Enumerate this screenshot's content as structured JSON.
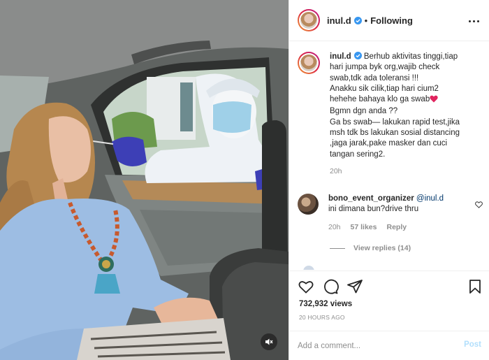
{
  "post": {
    "username": "inul.d",
    "follow_status": "Following",
    "separator": "•",
    "verified_icon": "verified-badge-icon",
    "photo_icon": "photo"
  },
  "caption": {
    "username": "inul.d",
    "lines": [
      "Berhub aktivitas tinggi,tiap",
      "hari jumpa byk org,wajib check",
      "swab,tdk ada toleransi !!!",
      "Anakku sik cilik,tiap hari cium2",
      "hehehe bahaya klo ga swab",
      "Bgmn dgn anda ??",
      "Ga bs swab— lakukan rapid test,jika",
      "msh tdk bs lakukan sosial distancing",
      ",jaga jarak,pake masker dan cuci",
      "tangan sering2."
    ],
    "emoji": "red-heart-icon",
    "time": "20h"
  },
  "comment": {
    "username": "bono_event_organizer",
    "mention": "@inul.d",
    "text": "ini dimana bun?drive thru",
    "time": "20h",
    "likes": "57 likes",
    "reply_label": "Reply",
    "view_replies": "View replies (14)"
  },
  "stats": {
    "views": "732,932 views",
    "posted": "20 HOURS AGO"
  },
  "add_comment": {
    "placeholder": "Add a comment...",
    "post_label": "Post"
  },
  "colors": {
    "link": "#00376b",
    "muted": "#8e8e8e",
    "post_disabled": "#b2dffc",
    "verified": "#3897f0",
    "heart": "#ed4956"
  }
}
